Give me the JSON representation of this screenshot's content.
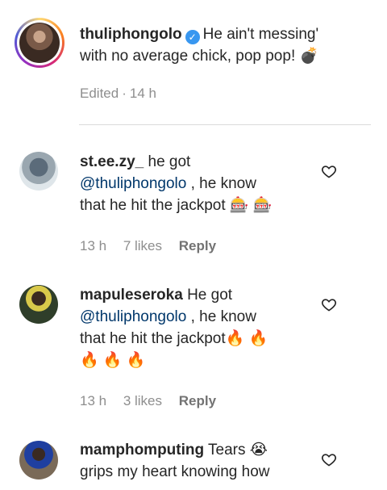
{
  "caption": {
    "username": "thuliphongolo",
    "text": "He ain't messing' with no average chick, pop pop! 💣",
    "line1": "He ain't messing'",
    "line2": "with no average chick, pop pop! 💣",
    "edited": "Edited",
    "time": "14 h"
  },
  "comments": [
    {
      "username": "st.ee.zy_",
      "pre": "he got",
      "mention": "@thuliphongolo",
      "text_after_mention": ", he know",
      "line3": "that he hit the jackpot 🎰 🎰",
      "time": "13 h",
      "likes": "7 likes",
      "reply": "Reply"
    },
    {
      "username": "mapuleseroka",
      "pre": "He got",
      "mention": "@thuliphongolo",
      "text_after_mention": ", he know",
      "line3": "that he hit the jackpot🔥 🔥",
      "line4": "🔥 🔥 🔥",
      "time": "13 h",
      "likes": "3 likes",
      "reply": "Reply"
    },
    {
      "username": "mamphomputing",
      "pre": "Tears 😭",
      "line2": "grips my heart knowing how"
    }
  ],
  "icons": {
    "verified": "verified-badge-icon",
    "heart": "heart-outline-icon"
  },
  "colors": {
    "mention": "#00376b",
    "verified": "#3897f0",
    "meta": "#8e8e8e"
  }
}
